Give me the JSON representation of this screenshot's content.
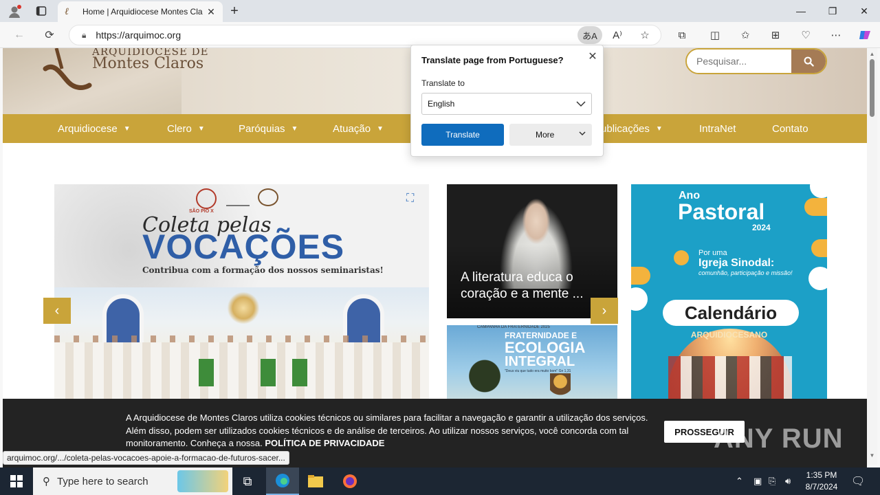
{
  "browser": {
    "tab_title": "Home | Arquidiocese Montes Cla",
    "url": "https://arquimoc.org",
    "status_url": "arquimoc.org/.../coleta-pelas-vocacoes-apoie-a-formacao-de-futuros-sacer..."
  },
  "site": {
    "logo_org": "ARQUIDIOCESE DE",
    "logo_city": "Montes Claros",
    "search_placeholder": "Pesquisar...",
    "nav": [
      {
        "label": "Arquidiocese",
        "has_dropdown": true
      },
      {
        "label": "Clero",
        "has_dropdown": true
      },
      {
        "label": "Paróquias",
        "has_dropdown": true
      },
      {
        "label": "Atuação",
        "has_dropdown": true
      },
      {
        "label": "Publicações",
        "has_dropdown": true
      },
      {
        "label": "IntraNet",
        "has_dropdown": false
      },
      {
        "label": "Contato",
        "has_dropdown": false
      }
    ],
    "slide": {
      "seal_label": "SÃO PIO X",
      "title_script": "Coleta pelas",
      "title_big": "VOCAÇÕES",
      "subtitle": "Contribua com a formação dos nossos seminaristas!"
    },
    "card_pope": {
      "title": "A literatura educa o coração e a mente ..."
    },
    "card_eco": {
      "kicker": "CAMPANHA DA FRATERNIDADE 2025",
      "line1": "FRATERNIDADE E",
      "line2": "ECOLOGIA",
      "line3": "INTEGRAL",
      "quote": "\"Deus viu que tudo era muito bom\" Gn 1,31"
    },
    "card_ano": {
      "line1": "Ano",
      "line2": "Pastoral",
      "line3": "2024",
      "line4": "Por uma",
      "line5": "Igreja Sinodal:",
      "line6": "comunhão, participação e missão!",
      "calendar": "Calendário",
      "calendar_sub": "ARQUIDIOCESANO"
    },
    "cookie": {
      "text": "A Arquidiocese de Montes Claros utiliza cookies técnicos ou similares para facilitar a navegação e garantir a utilização dos serviços. Além disso, podem ser utilizados cookies técnicos e de análise de terceiros. Ao utilizar nossos serviços, você concorda com tal monitoramento. Conheça a nossa.",
      "policy": "POLÍTICA DE PRIVACIDADE",
      "button": "PROSSEGUIR"
    },
    "watermark": "ANY RUN"
  },
  "translate_popup": {
    "title": "Translate page from Portuguese?",
    "label": "Translate to",
    "selected_language": "English",
    "translate_button": "Translate",
    "more_button": "More"
  },
  "taskbar": {
    "search_placeholder": "Type here to search",
    "time": "1:35 PM",
    "date": "8/7/2024"
  },
  "colors": {
    "accent_gold": "#c9a43a",
    "search_button": "#a57b55",
    "translate_blue": "#0f6cbd",
    "card_blue": "#1ca0c7"
  }
}
